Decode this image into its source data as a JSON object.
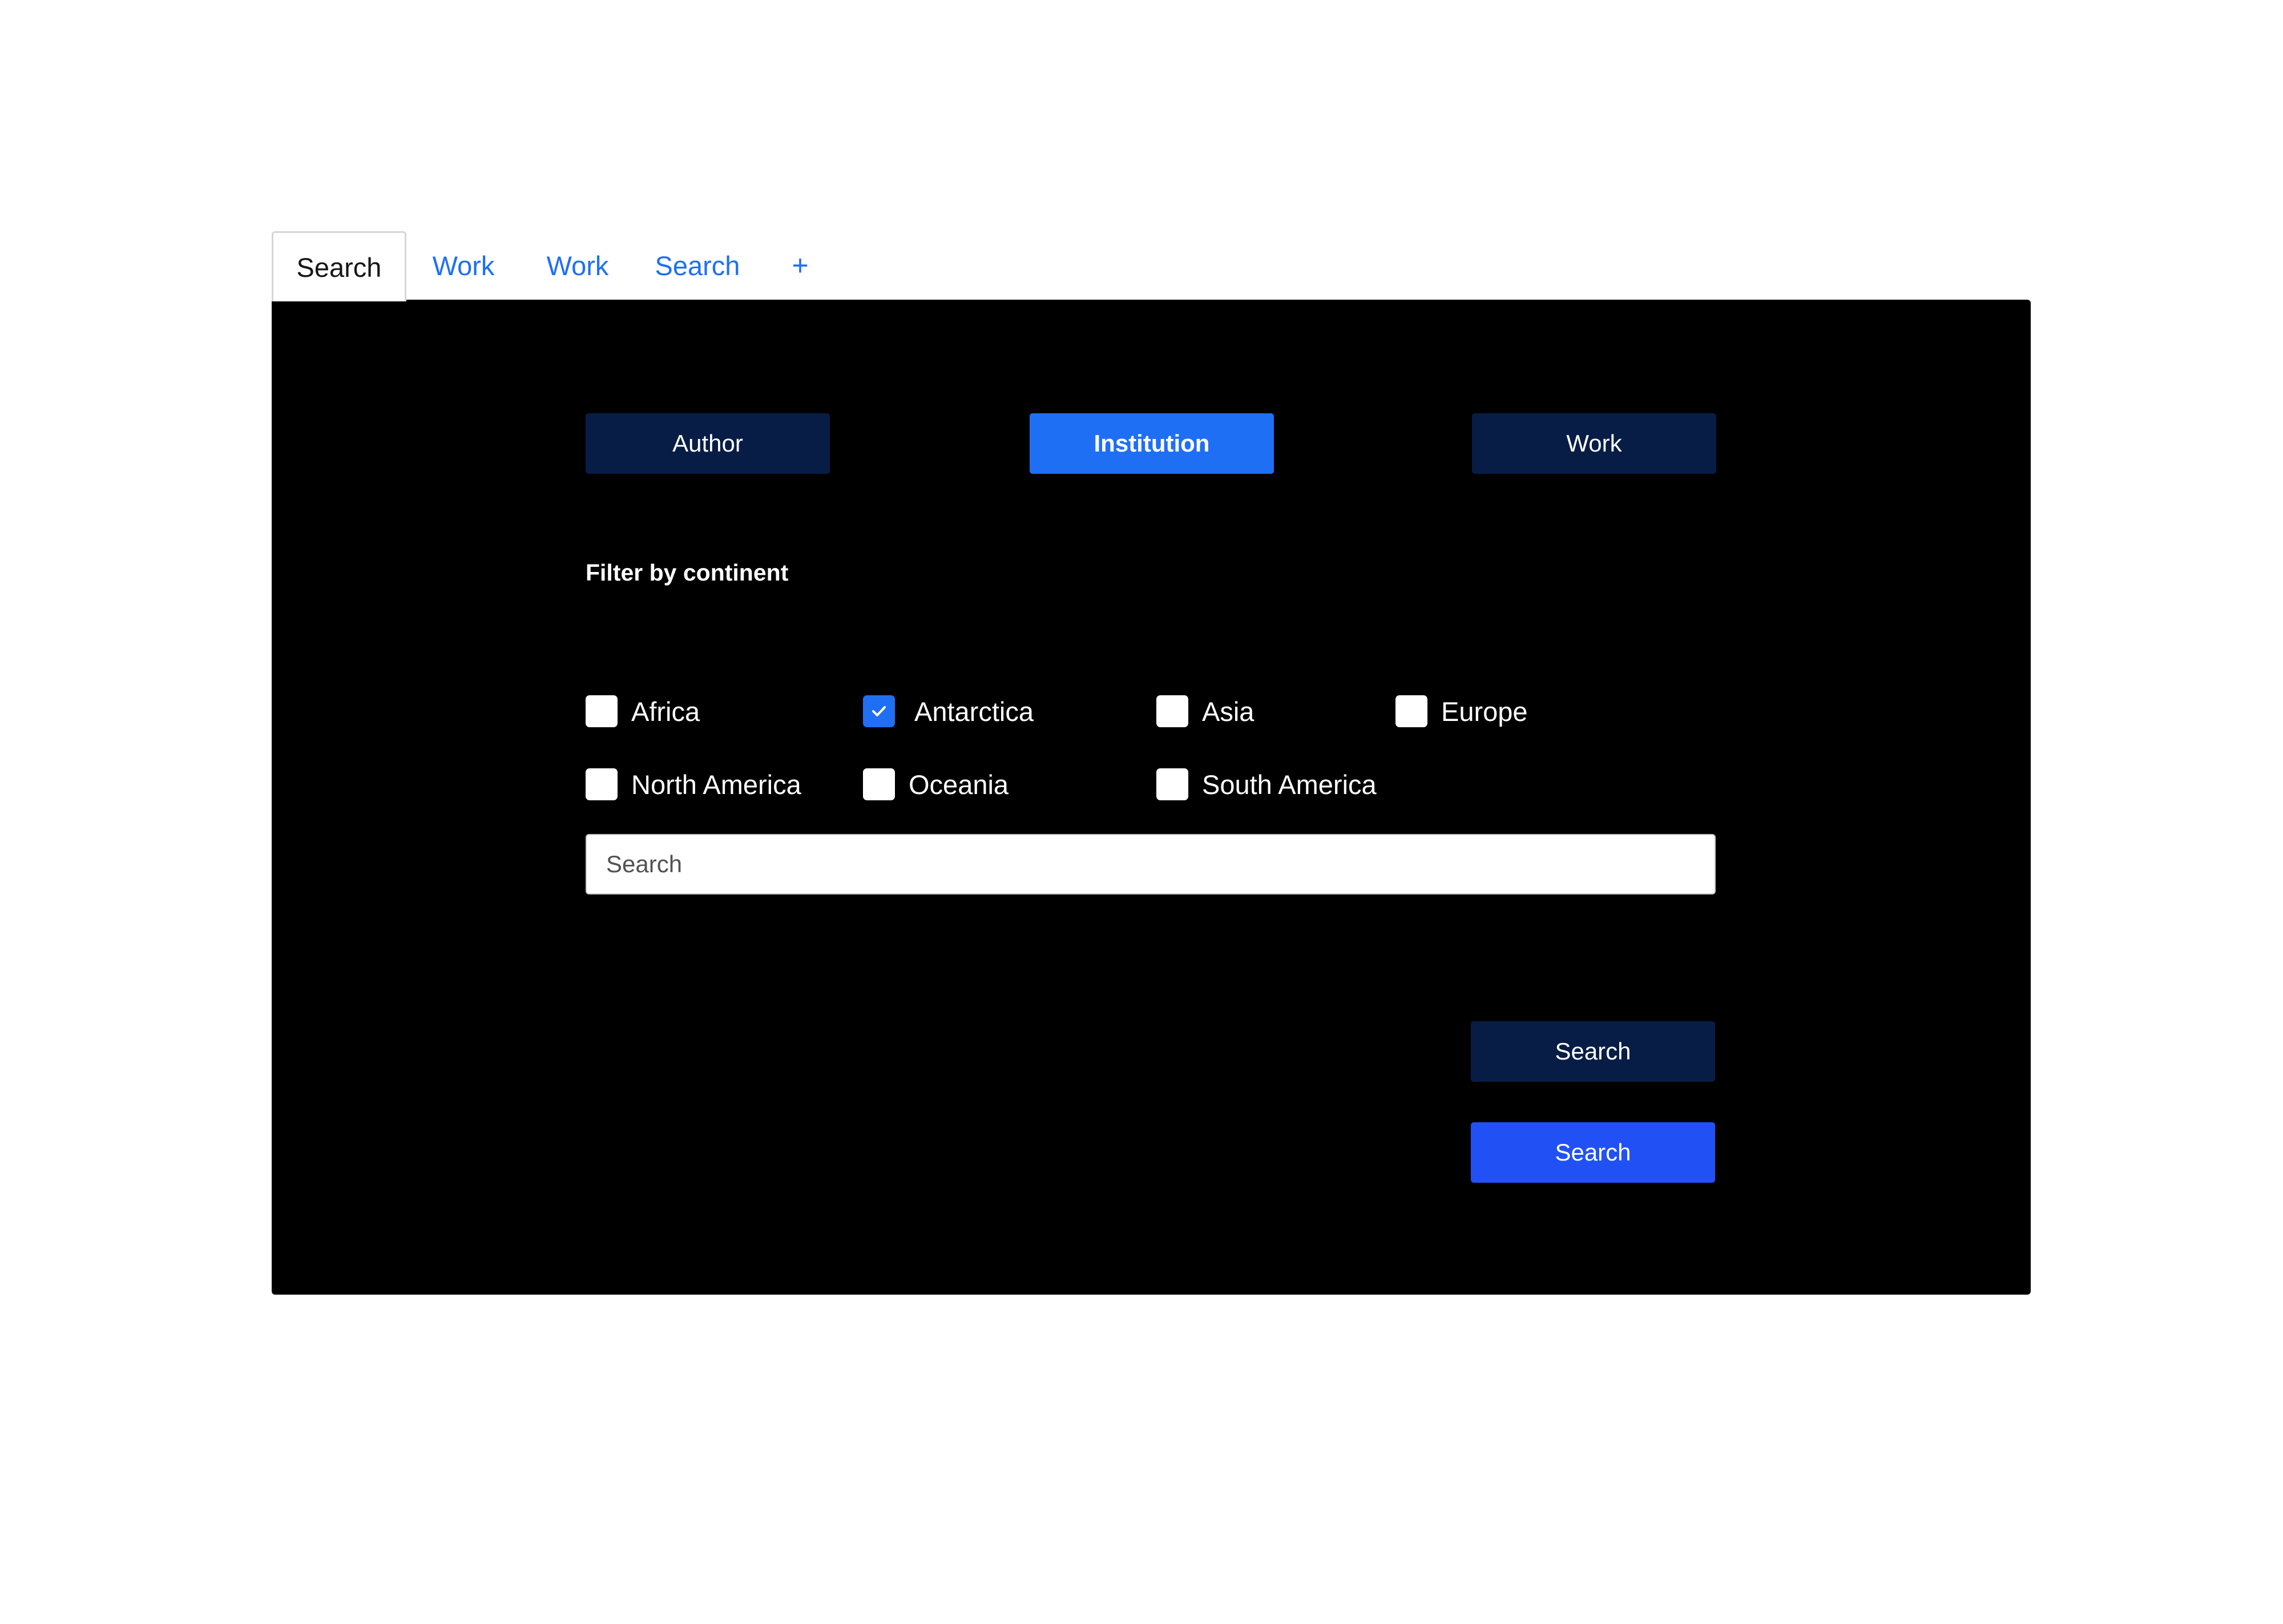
{
  "tabs": [
    {
      "label": "Search",
      "active": true
    },
    {
      "label": "Work",
      "active": false
    },
    {
      "label": "Work",
      "active": false
    },
    {
      "label": "Search",
      "active": false
    }
  ],
  "add_tab_label": "+",
  "segments": {
    "author": "Author",
    "institution": "Institution",
    "work": "Work",
    "selected": "Institution"
  },
  "filter": {
    "title": "Filter by continent",
    "options": [
      {
        "label": "Africa",
        "checked": false
      },
      {
        "label": "Antarctica",
        "checked": true
      },
      {
        "label": "Asia",
        "checked": false
      },
      {
        "label": "Europe",
        "checked": false
      },
      {
        "label": "North America",
        "checked": false
      },
      {
        "label": "Oceania",
        "checked": false
      },
      {
        "label": "South America",
        "checked": false
      }
    ]
  },
  "search": {
    "placeholder": "Search",
    "value": ""
  },
  "buttons": {
    "secondary_label": "Search",
    "primary_label": "Search"
  },
  "colors": {
    "accent": "#1f6ff5",
    "primary_button": "#2151f5",
    "dark_button": "#071d45",
    "panel_background": "#000000",
    "tab_link": "#1f6ff5"
  },
  "icons": {
    "checkbox_checked": "checkmark-icon",
    "add_tab": "plus-icon"
  }
}
